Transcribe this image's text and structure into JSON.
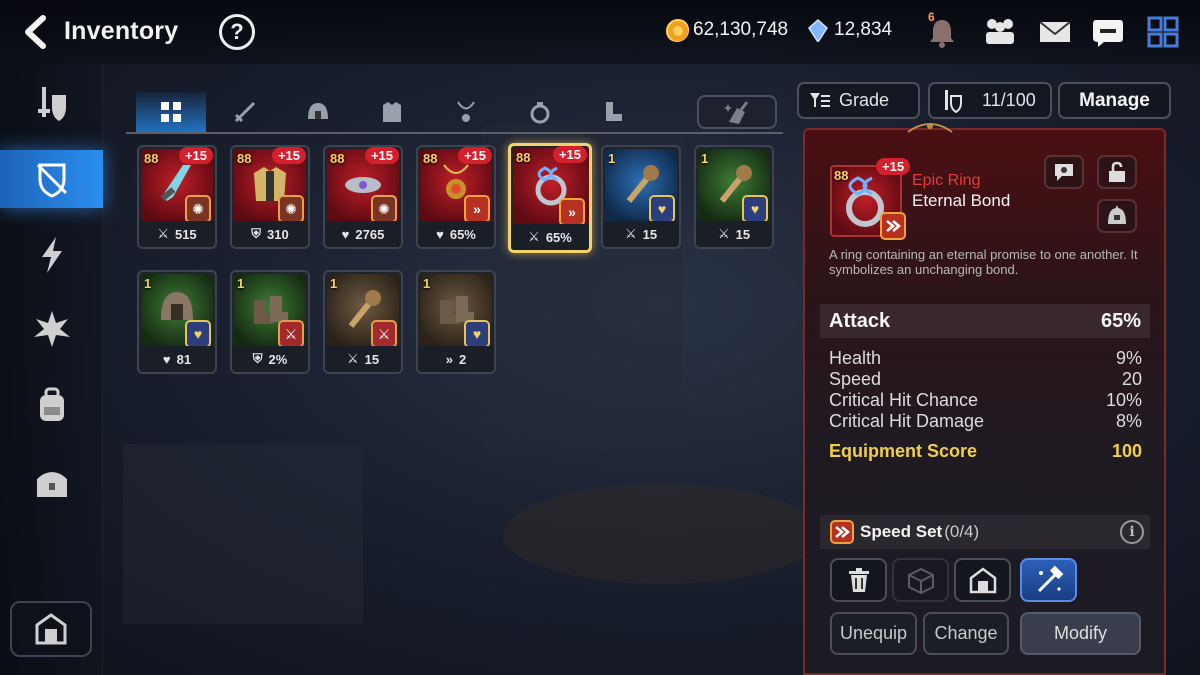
{
  "header": {
    "title": "Inventory",
    "help": "?",
    "gold": "62,130,748",
    "crystals": "12,834",
    "notifications": "6"
  },
  "inventory": {
    "items": [
      {
        "level": "88",
        "plus": "+15",
        "color": "red",
        "set": "crit",
        "stat_icon": "attack-icon",
        "stat": "515",
        "selected": false
      },
      {
        "level": "88",
        "plus": "+15",
        "color": "red",
        "set": "crit",
        "stat_icon": "defense-icon",
        "stat": "310",
        "selected": false
      },
      {
        "level": "88",
        "plus": "+15",
        "color": "red",
        "set": "crit",
        "stat_icon": "health-icon",
        "stat": "2765",
        "selected": false
      },
      {
        "level": "88",
        "plus": "+15",
        "color": "red",
        "set": "speed",
        "stat_icon": "health-icon",
        "stat": "65%",
        "selected": false
      },
      {
        "level": "88",
        "plus": "+15",
        "color": "red",
        "set": "speed",
        "stat_icon": "attack-icon",
        "stat": "65%",
        "selected": true
      },
      {
        "level": "1",
        "plus": "",
        "color": "blue",
        "set": "hp",
        "stat_icon": "attack-icon",
        "stat": "15",
        "selected": false
      },
      {
        "level": "1",
        "plus": "",
        "color": "green",
        "set": "hp",
        "stat_icon": "attack-icon",
        "stat": "15",
        "selected": false
      },
      {
        "level": "1",
        "plus": "",
        "color": "green",
        "set": "hp",
        "stat_icon": "health-icon",
        "stat": "81",
        "selected": false
      },
      {
        "level": "1",
        "plus": "",
        "color": "green",
        "set": "atk",
        "stat_icon": "defense-icon",
        "stat": "2%",
        "selected": false
      },
      {
        "level": "1",
        "plus": "",
        "color": "brown",
        "set": "atk",
        "stat_icon": "attack-icon",
        "stat": "15",
        "selected": false
      },
      {
        "level": "1",
        "plus": "",
        "color": "brown",
        "set": "hp",
        "stat_icon": "speed-icon",
        "stat": "2",
        "selected": false
      }
    ]
  },
  "filters": {
    "grade_label": "Grade",
    "capacity": "11/100",
    "manage_label": "Manage"
  },
  "detail": {
    "level": "88",
    "plus": "+15",
    "grade": "Epic Ring",
    "name": "Eternal Bond",
    "description": "A ring containing an eternal promise to one another. It symbolizes an unchanging bond.",
    "main_stat": {
      "label": "Attack",
      "value": "65%"
    },
    "substats": [
      {
        "label": "Health",
        "value": "9%"
      },
      {
        "label": "Speed",
        "value": "20"
      },
      {
        "label": "Critical Hit Chance",
        "value": "10%"
      },
      {
        "label": "Critical Hit Damage",
        "value": "8%"
      }
    ],
    "score": {
      "label": "Equipment Score",
      "value": "100"
    },
    "set": {
      "name": "Speed Set",
      "count": "(0/4)"
    },
    "buttons": {
      "unequip": "Unequip",
      "change": "Change",
      "modify": "Modify"
    }
  },
  "colors": {
    "accent": "#2b8ff0",
    "epic": "#e43b3b",
    "score": "#f0d04a",
    "plus_badge": "#d3202c"
  }
}
